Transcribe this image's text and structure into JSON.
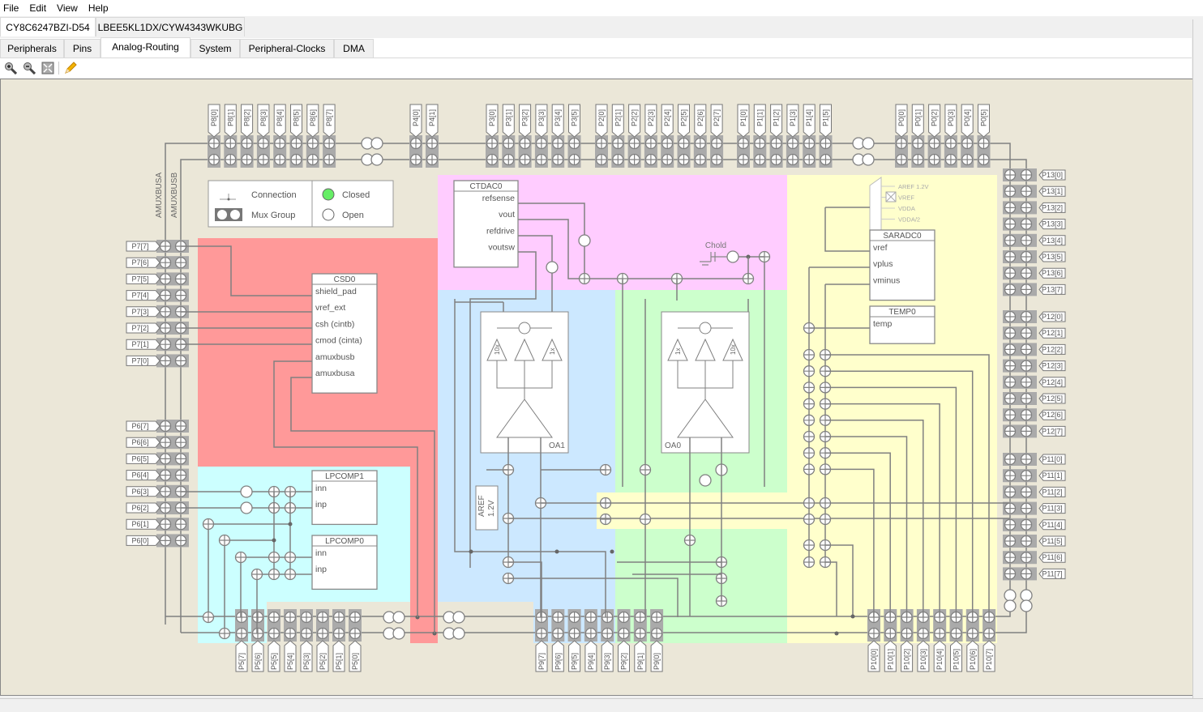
{
  "menu": [
    "File",
    "Edit",
    "View",
    "Help"
  ],
  "device_tabs": [
    {
      "label": "CY8C6247BZI-D54",
      "active": true
    },
    {
      "label": "LBEE5KL1DX/CYW4343WKUBG",
      "active": false
    }
  ],
  "tabs": [
    {
      "label": "Peripherals",
      "active": false
    },
    {
      "label": "Pins",
      "active": false
    },
    {
      "label": "Analog-Routing",
      "active": true
    },
    {
      "label": "System",
      "active": false
    },
    {
      "label": "Peripheral-Clocks",
      "active": false
    },
    {
      "label": "DMA",
      "active": false
    }
  ],
  "toolbar": {
    "icons": [
      "zoom-in-icon",
      "zoom-out-icon",
      "zoom-fit-icon",
      "pencil-icon"
    ]
  },
  "legend": {
    "connection": "Connection",
    "mux_group": "Mux Group",
    "closed": "Closed",
    "open": "Open"
  },
  "bus_labels": {
    "a": "AMUXBUSA",
    "b": "AMUXBUSB"
  },
  "colors": {
    "canvas_bg": "#ebe7d8",
    "csd": "#ff9999",
    "ctdac": "#ffccff",
    "opamp1": "#cce8ff",
    "opamp0": "#ccffcc",
    "sar": "#ffffcc",
    "lpcomp": "#ccffff",
    "closed": "#66ee66"
  },
  "ports": {
    "top_left": [
      "P8[0]",
      "P8[1]",
      "P8[2]",
      "P8[3]",
      "P8[4]",
      "P8[5]",
      "P8[6]",
      "P8[7]"
    ],
    "top_p4": [
      "P4[0]",
      "P4[1]"
    ],
    "top_p3": [
      "P3[0]",
      "P3[1]",
      "P3[2]",
      "P3[3]",
      "P3[4]",
      "P3[5]"
    ],
    "top_p2": [
      "P2[0]",
      "P2[1]",
      "P2[2]",
      "P2[3]",
      "P2[4]",
      "P2[5]",
      "P2[6]",
      "P2[7]"
    ],
    "top_p1": [
      "P1[0]",
      "P1[1]",
      "P1[2]",
      "P1[3]",
      "P1[4]",
      "P1[5]"
    ],
    "top_p0": [
      "P0[0]",
      "P0[1]",
      "P0[2]",
      "P0[3]",
      "P0[4]",
      "P0[5]"
    ],
    "left_p7": [
      "P7[7]",
      "P7[6]",
      "P7[5]",
      "P7[4]",
      "P7[3]",
      "P7[2]",
      "P7[1]",
      "P7[0]"
    ],
    "left_p6": [
      "P6[7]",
      "P6[6]",
      "P6[5]",
      "P6[4]",
      "P6[3]",
      "P6[2]",
      "P6[1]",
      "P6[0]"
    ],
    "bottom_p5": [
      "P5[7]",
      "P5[6]",
      "P5[5]",
      "P5[4]",
      "P5[3]",
      "P5[2]",
      "P5[1]",
      "P5[0]"
    ],
    "bottom_p9": [
      "P9[7]",
      "P9[6]",
      "P9[5]",
      "P9[4]",
      "P9[3]",
      "P9[2]",
      "P9[1]",
      "P9[0]"
    ],
    "bottom_p10": [
      "P10[0]",
      "P10[1]",
      "P10[2]",
      "P10[3]",
      "P10[4]",
      "P10[5]",
      "P10[6]",
      "P10[7]"
    ],
    "right_p13": [
      "P13[0]",
      "P13[1]",
      "P13[2]",
      "P13[3]",
      "P13[4]",
      "P13[5]",
      "P13[6]",
      "P13[7]"
    ],
    "right_p12": [
      "P12[0]",
      "P12[1]",
      "P12[2]",
      "P12[3]",
      "P12[4]",
      "P12[5]",
      "P12[6]",
      "P12[7]"
    ],
    "right_p11": [
      "P11[0]",
      "P11[1]",
      "P11[2]",
      "P11[3]",
      "P11[4]",
      "P11[5]",
      "P11[6]",
      "P11[7]"
    ]
  },
  "blocks": {
    "csd": {
      "title": "CSD0",
      "pins": [
        "shield_pad",
        "vref_ext",
        "csh (cintb)",
        "cmod (cinta)",
        "amuxbusb",
        "amuxbusa"
      ]
    },
    "ctdac": {
      "title": "CTDAC0",
      "pins": [
        "refsense",
        "vout",
        "refdrive",
        "voutsw"
      ]
    },
    "chold": "Chold",
    "saradc": {
      "title": "SARADC0",
      "pins": [
        "vref",
        "vplus",
        "vminus"
      ]
    },
    "vref_mux": [
      "AREF 1.2V",
      "VREF",
      "VDDA",
      "VDDA/2"
    ],
    "temp": {
      "title": "TEMP0",
      "pins": [
        "temp"
      ]
    },
    "lpcomp1": {
      "title": "LPCOMP1",
      "pins": [
        "inn",
        "inp"
      ]
    },
    "lpcomp0": {
      "title": "LPCOMP0",
      "pins": [
        "inn",
        "inp"
      ]
    },
    "oa1": {
      "label": "OA1",
      "gains": [
        "10x",
        "1x"
      ]
    },
    "oa0": {
      "label": "OA0",
      "gains": [
        "1x",
        "10x"
      ]
    },
    "aref": {
      "line1": "AREF",
      "line2": "1.2V"
    }
  }
}
